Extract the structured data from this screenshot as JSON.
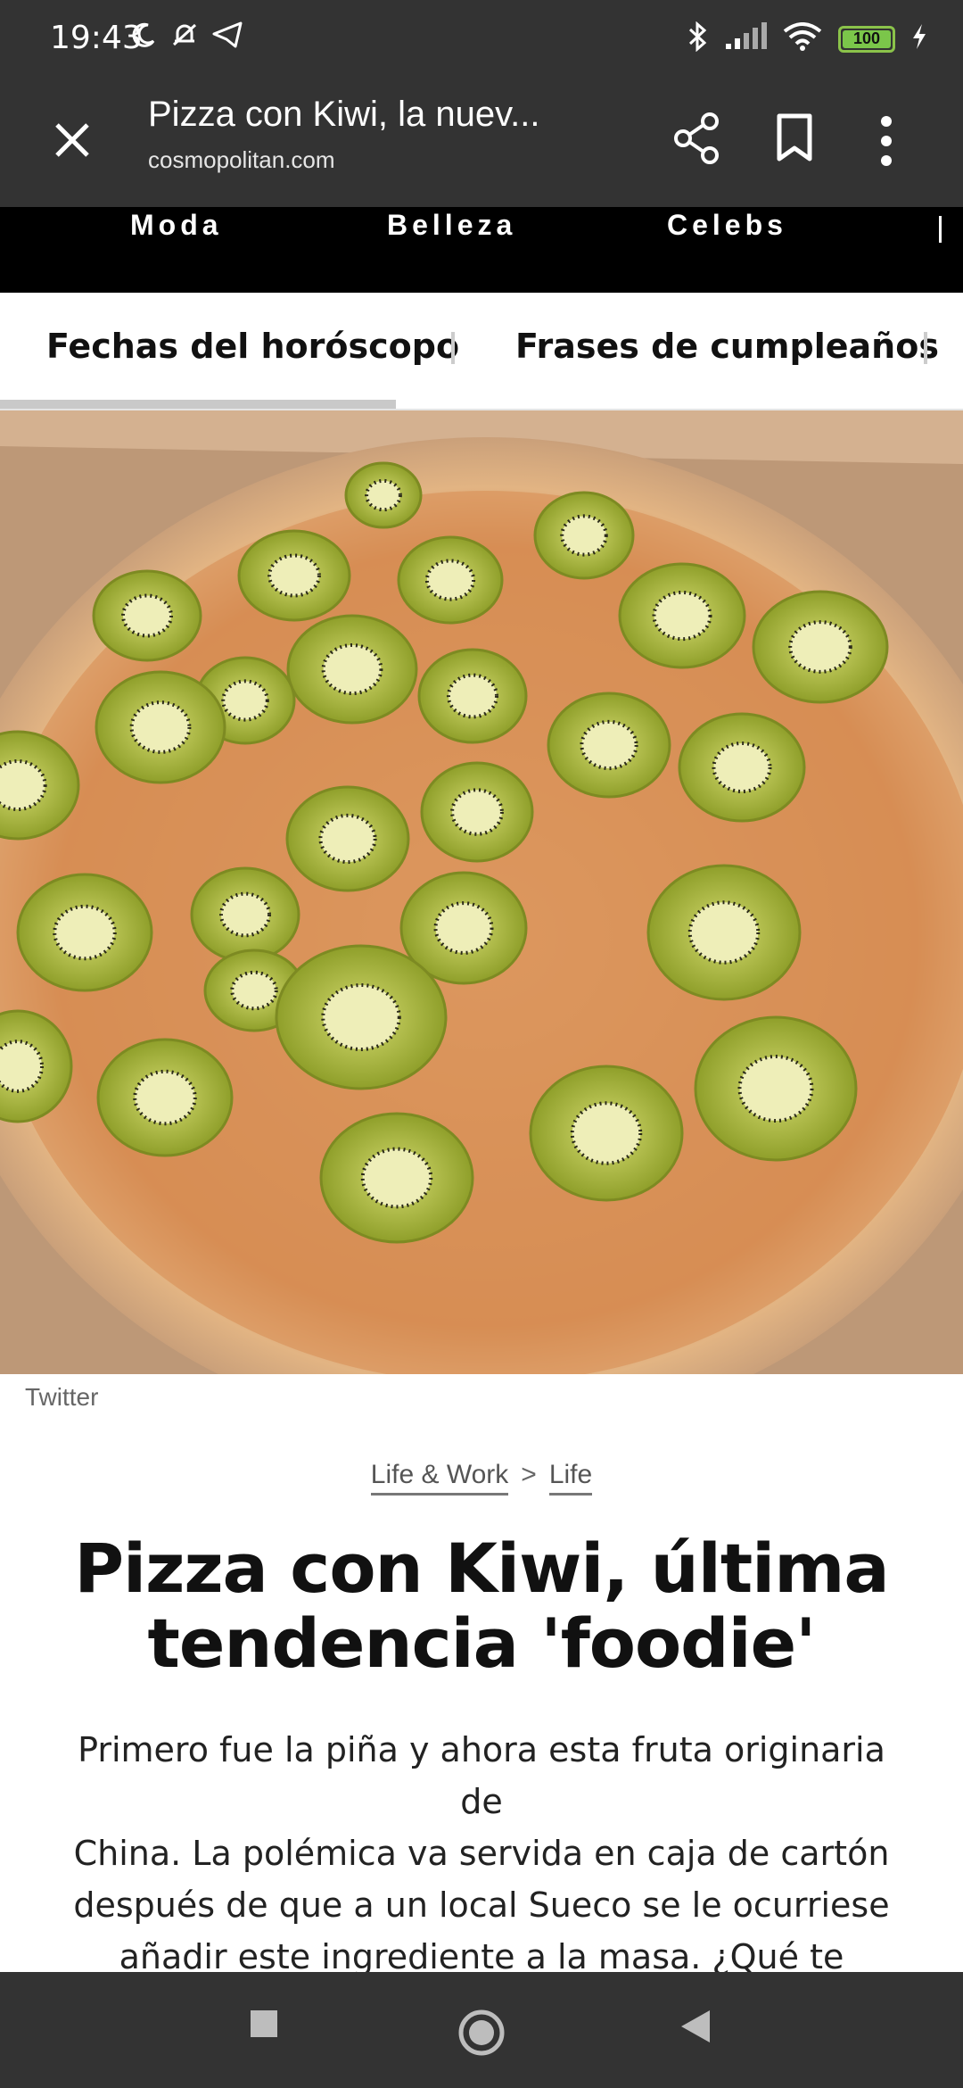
{
  "status_bar": {
    "time": "19:43",
    "battery": "100",
    "icons_left": [
      "moon-icon",
      "bell-off-icon",
      "telegram-icon"
    ],
    "icons_right": [
      "bluetooth-icon",
      "signal-icon",
      "wifi-icon",
      "battery-icon",
      "charging-icon"
    ]
  },
  "browser": {
    "title": "Pizza con Kiwi, la nuev...",
    "domain": "cosmopolitan.com",
    "icons": [
      "close-icon",
      "share-icon",
      "bookmark-icon",
      "more-vert-icon"
    ]
  },
  "main_nav": {
    "items": [
      "Moda",
      "Belleza",
      "Celebs"
    ]
  },
  "sub_nav": {
    "tabs": [
      "Fechas del horóscopo",
      "Frases de cumpleaños"
    ]
  },
  "article": {
    "image_credit": "Twitter",
    "breadcrumb": [
      "Life & Work",
      "Life"
    ],
    "breadcrumb_separator": ">",
    "headline_line1": "Pizza con Kiwi, última",
    "headline_line2": "tendencia 'foodie'",
    "dek_lines": [
      "Primero fue la piña y ahora esta fruta originaria de",
      "China. La polémica va servida en caja de cartón",
      "después de que a un local Sueco se le ocurriese",
      "añadir este ingrediente a la masa. ¿Qué te parece?"
    ]
  },
  "system_nav": {
    "buttons": [
      "recents-button",
      "home-button",
      "back-button"
    ]
  },
  "colors": {
    "chrome_bg": "#333333",
    "nav_bg": "#000000",
    "kiwi": "#a8b832",
    "crust": "#d7a26a"
  }
}
